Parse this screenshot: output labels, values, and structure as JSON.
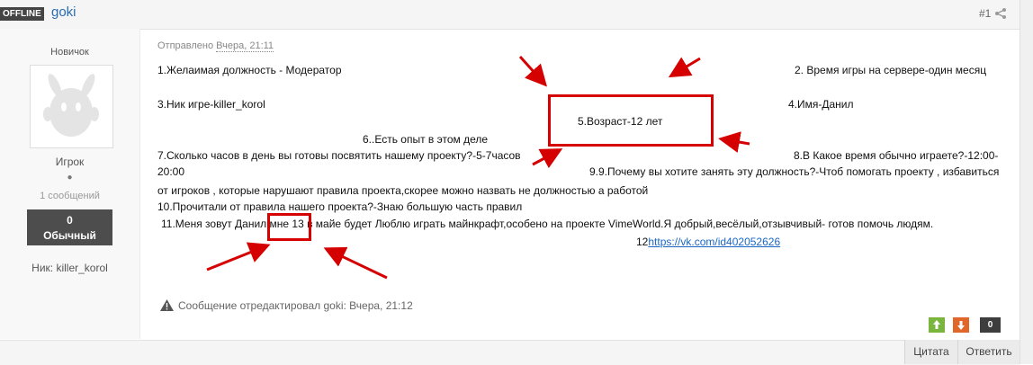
{
  "header": {
    "status_badge": "OFFLINE",
    "author": "goki",
    "post_number": "#1"
  },
  "sidebar": {
    "rank": "Новичок",
    "group": "Игрок",
    "posts": "1 сообщений",
    "reputation_value": "0",
    "reputation_label": "Обычный",
    "nickname": "Ник: killer_korol"
  },
  "post": {
    "sent_prefix": "Отправлено",
    "sent_time": "Вчера, 21:11",
    "lines": [
      "1.Желаимая должность - Модератор",
      "2. Время игры на сервере-один месяц",
      "3.Ник игре-killer_korol",
      "4.Имя-Данил",
      "5.Возраст-12 лет",
      "6..Есть опыт в этом деле",
      "7.Сколько часов в день вы готовы посвятить нашему проекту?-5-7часов",
      "8.В Какое время обычно играете?-12:00-",
      "20:00",
      "9.9.Почему вы хотите занять эту должность?-Чтоб помогать проекту , избавиться",
      "от игроков , которые нарушают правила проекта,скорее можно назвать не должностью а работой",
      "10.Прочитали от правила нашего проекта?-Знаю большую часть правил",
      "11.Меня зовут Данил мне 13 в майе будет Люблю играть майнкрафт,особено на проекте VimeWorld.Я добрый,весёлый,отзывчивый- готов помочь людям."
    ],
    "link_prefix": "12",
    "link_text": "https://vk.com/id402052626",
    "edited_note": "Сообщение отредактировал goki: Вчера, 21:12"
  },
  "votes": {
    "count": "0"
  },
  "actions": {
    "quote": "Цитата",
    "reply": "Ответить"
  }
}
